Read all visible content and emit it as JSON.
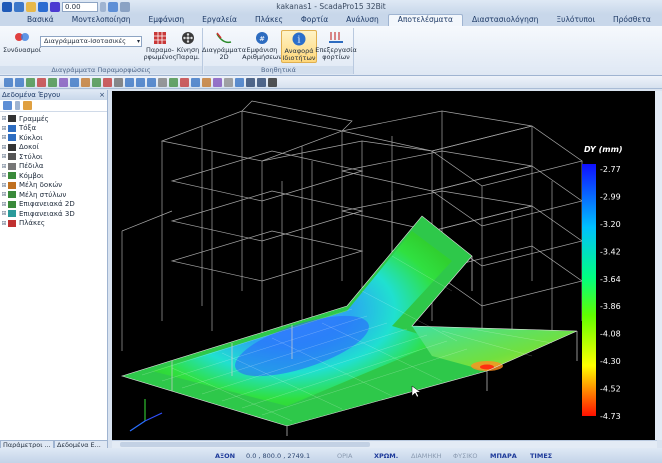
{
  "window": {
    "title": "kakanas1 - ScadaPro15 32Bit",
    "quick_value": "0.00"
  },
  "tabs": [
    "Βασικά",
    "Μοντελοποίηση",
    "Εμφάνιση",
    "Εργαλεία",
    "Πλάκες",
    "Φορτία",
    "Ανάλυση",
    "Αποτελέσματα",
    "Διαστασιολόγηση",
    "Ξυλότυποι",
    "Πρόσθετα"
  ],
  "active_tab": "Αποτελέσματα",
  "ribbon": {
    "sindiasmoi": "Συνδυασμοί",
    "combo_value": "Διαγράμματα-Ισοτασικές",
    "btn_paramorfomenos": "Παραμο-ρφωμένος",
    "btn_kinisi": "Κίνηση Παραμ.",
    "group1_label": "Διαγράμματα Παραμορφώσεις",
    "btn_diagrammata": "Διαγράμματα 2D",
    "btn_emfanisi": "Εμφάνιση Αριθμήσεων",
    "btn_anafora": "Αναφορά Ιδιοτήτων",
    "btn_epexergasia": "Επεξεργασία φορτίων",
    "group2_label": "Βοηθητικά"
  },
  "panel": {
    "title": "Δεδομένα Έργου",
    "pin": "ᵖ",
    "close": "×",
    "items": [
      "Γραμμές",
      "Τόξα",
      "Κύκλοι",
      "Δοκοί",
      "Στύλοι",
      "Πέδιλα",
      "Κόμβοι",
      "Μέλη δοκών",
      "Μέλη στύλων",
      "Επιφανειακά 2D",
      "Επιφανειακά 3D",
      "Πλάκες"
    ],
    "tab1": "Παράμετροι ...",
    "tab2": "Δεδομένα Ε..."
  },
  "legend": {
    "title": "DY (mm)",
    "values": [
      "-2.77",
      "-2.99",
      "-3.20",
      "-3.42",
      "-3.64",
      "-3.86",
      "-4.08",
      "-4.30",
      "-4.52",
      "-4.73"
    ]
  },
  "status": {
    "axon": "ΑΞΟΝ",
    "coords": "0.0 , 800.0 , 2749.1",
    "oria": "ΟΡΙΑ",
    "xrom": "ΧΡΩΜ.",
    "diamini": "ΔΙΑΜΗΚΗ",
    "fysiko": "ΦΥΣΙΚΟ",
    "mpara": "ΜΠΑΡΑ",
    "times": "ΤΙΜΕΣ"
  },
  "colors": {
    "ribbon_active": "#f3f7fc",
    "viewport": "#000000"
  }
}
